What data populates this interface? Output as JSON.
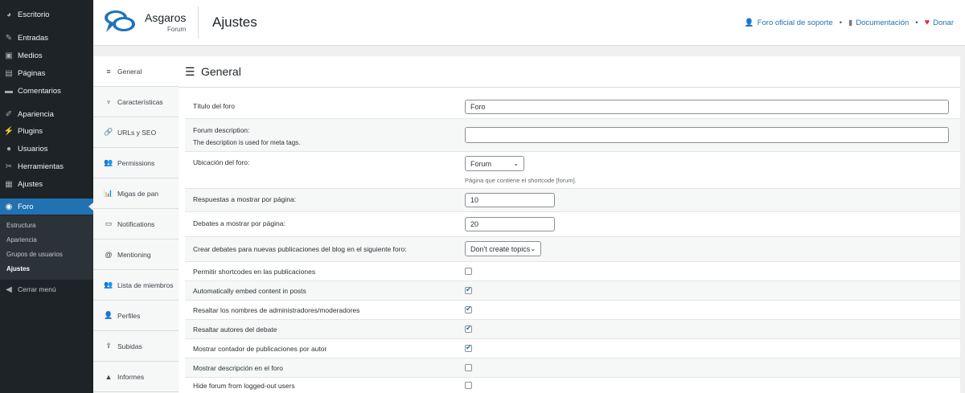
{
  "sidebar": {
    "items": [
      {
        "icon": "dashboard-icon",
        "glyph": "◕",
        "label": "Escritorio"
      },
      {
        "icon": "pin-icon",
        "glyph": "✎",
        "label": "Entradas"
      },
      {
        "icon": "media-icon",
        "glyph": "▣",
        "label": "Medios"
      },
      {
        "icon": "page-icon",
        "glyph": "▤",
        "label": "Páginas"
      },
      {
        "icon": "comment-icon",
        "glyph": "▬",
        "label": "Comentarios"
      },
      {
        "icon": "brush-icon",
        "glyph": "✐",
        "label": "Apariencia"
      },
      {
        "icon": "plugin-icon",
        "glyph": "⚡",
        "label": "Plugins"
      },
      {
        "icon": "user-icon",
        "glyph": "●",
        "label": "Usuarios"
      },
      {
        "icon": "wrench-icon",
        "glyph": "✂",
        "label": "Herramientas"
      },
      {
        "icon": "settings-icon",
        "glyph": "▦",
        "label": "Ajustes"
      },
      {
        "icon": "forum-icon",
        "glyph": "◉",
        "label": "Foro"
      }
    ],
    "submenu": [
      "Estructura",
      "Apariencia",
      "Grupos de usuarios",
      "Ajustes"
    ],
    "collapse": {
      "icon": "collapse-icon",
      "glyph": "◀",
      "label": "Cerrar menú"
    }
  },
  "header": {
    "brand": "Asgaros",
    "brand_sub": "Forum",
    "page_title": "Ajustes",
    "links": [
      {
        "icon": "person-icon",
        "glyph": "👤",
        "label": "Foro oficial de soporte"
      },
      {
        "icon": "book-icon",
        "glyph": "▮",
        "label": "Documentación"
      },
      {
        "icon": "heart-icon",
        "glyph": "♥",
        "label": "Donar"
      }
    ],
    "separator": "•"
  },
  "tabs": [
    {
      "icon": "menu-lines-icon",
      "glyph": "≡",
      "label": "General"
    },
    {
      "icon": "plug-icon",
      "glyph": "♆",
      "label": "Características"
    },
    {
      "icon": "link-icon",
      "glyph": "🔗",
      "label": "URLs y SEO"
    },
    {
      "icon": "users-icon",
      "glyph": "👥",
      "label": "Permissions"
    },
    {
      "icon": "breadcrumb-icon",
      "glyph": "📊",
      "label": "Migas de pan"
    },
    {
      "icon": "notification-icon",
      "glyph": "▭",
      "label": "Notifications"
    },
    {
      "icon": "at-icon",
      "glyph": "@",
      "label": "Mentioning"
    },
    {
      "icon": "members-icon",
      "glyph": "👥",
      "label": "Lista de miembros"
    },
    {
      "icon": "profile-icon",
      "glyph": "👤",
      "label": "Perfiles"
    },
    {
      "icon": "upload-icon",
      "glyph": "⇪",
      "label": "Subidas"
    },
    {
      "icon": "warning-icon",
      "glyph": "▲",
      "label": "Informes"
    }
  ],
  "main": {
    "title": "General",
    "rows": [
      {
        "label": "Título del foro",
        "type": "text",
        "value": "Foro"
      },
      {
        "label": "Forum description:",
        "desc": "The description is used for meta tags.",
        "type": "textarea",
        "value": ""
      },
      {
        "label": "Ubicación del foro:",
        "type": "select",
        "value": "Forum",
        "hint": "Página que contiene el shortcode [forum]."
      },
      {
        "label": "Respuestas a mostrar por página:",
        "type": "number",
        "value": "10"
      },
      {
        "label": "Debates a mostrar por página:",
        "type": "number",
        "value": "20"
      },
      {
        "label": "Crear debates para nuevas publicaciones del blog en el siguiente foro:",
        "type": "select",
        "value": "Don't create topics"
      },
      {
        "label": "Permitir shortcodes en las publicaciones",
        "type": "checkbox",
        "checked": false
      },
      {
        "label": "Automatically embed content in posts",
        "type": "checkbox",
        "checked": true
      },
      {
        "label": "Resaltar los nombres de administradores/moderadores",
        "type": "checkbox",
        "checked": true
      },
      {
        "label": "Resaltar autores del debate",
        "type": "checkbox",
        "checked": true
      },
      {
        "label": "Mostrar contador de publicaciones por autor",
        "type": "checkbox",
        "checked": true
      },
      {
        "label": "Mostrar descripción en el foro",
        "type": "checkbox",
        "checked": false
      },
      {
        "label": "Hide forum from logged-out users",
        "type": "checkbox",
        "checked": false
      }
    ]
  },
  "colors": {
    "accent": "#2271b1",
    "admin_bar": "#1d2327",
    "donate_heart": "#d63638"
  }
}
